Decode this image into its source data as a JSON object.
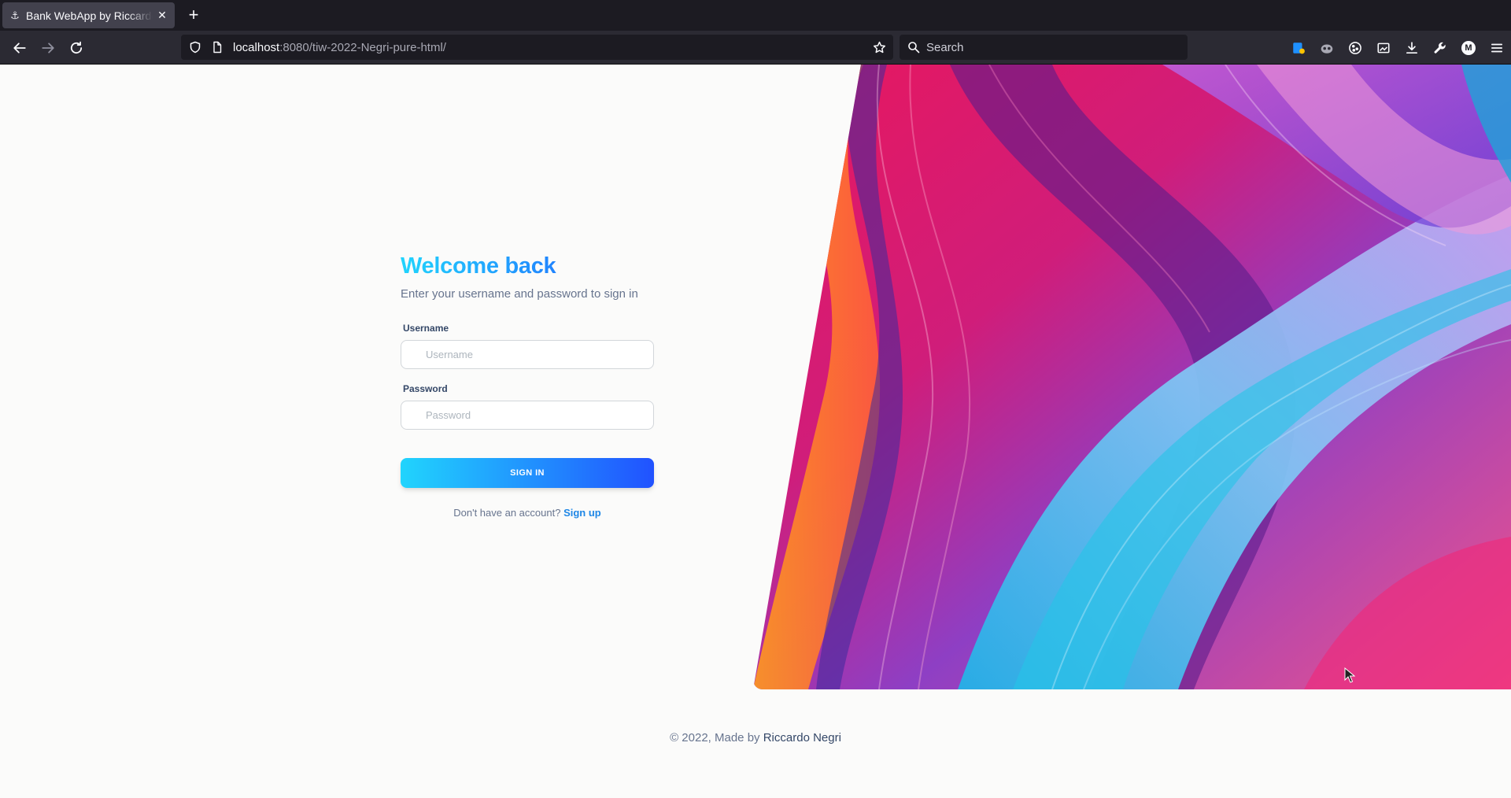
{
  "browser": {
    "tab": {
      "title": "Bank WebApp by Riccardo Negri",
      "icon": "anchor-icon",
      "close_icon": "close-icon"
    },
    "new_tab_icon": "plus-icon",
    "url": {
      "host": "localhost",
      "rest": ":8080/tiw-2022-Negri-pure-html/"
    },
    "search": {
      "placeholder": "Search"
    },
    "toolbar_icons": [
      "extension-icon",
      "privacy-icon",
      "cookie-icon",
      "screenshot-icon",
      "download-icon",
      "wrench-icon",
      "account-icon",
      "menu-icon"
    ],
    "account_initial": "M"
  },
  "login": {
    "title": "Welcome back",
    "subtitle": "Enter your username and password to sign in",
    "username_label": "Username",
    "username_placeholder": "Username",
    "username_value": "",
    "password_label": "Password",
    "password_placeholder": "Password",
    "password_value": "",
    "submit_label": "SIGN IN",
    "signup_prompt": "Don't have an account?",
    "signup_link": "Sign up"
  },
  "footer": {
    "prefix": "© 2022, Made by",
    "author": "Riccardo Negri"
  },
  "colors": {
    "accent_start": "#21d4fd",
    "accent_end": "#2152ff",
    "link": "#1f87e6",
    "text_muted": "#67748e",
    "text_dark": "#344767"
  }
}
